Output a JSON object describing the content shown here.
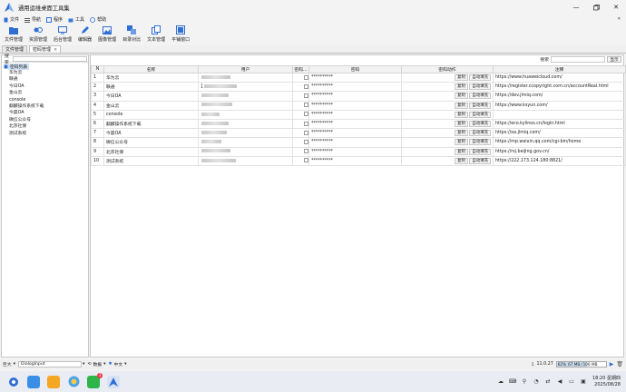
{
  "window": {
    "title": "通用运维桌面工具集",
    "controls": [
      "minimize",
      "restore",
      "close"
    ]
  },
  "menubar": [
    {
      "label": "文件",
      "icon": "file-icon"
    },
    {
      "label": "导航",
      "icon": "nav-icon"
    },
    {
      "label": "程序",
      "icon": "program-icon"
    },
    {
      "label": "工具",
      "icon": "tool-icon"
    },
    {
      "label": "帮助",
      "icon": "help-icon"
    }
  ],
  "toolbar": [
    {
      "label": "文件管理",
      "icon": "folder-icon"
    },
    {
      "label": "资源管理",
      "icon": "resource-icon"
    },
    {
      "label": "后台管理",
      "icon": "monitor-icon"
    },
    {
      "label": "编辑器",
      "icon": "edit-icon"
    },
    {
      "label": "图像管理",
      "icon": "image-icon"
    },
    {
      "label": "目录对比",
      "icon": "compare-icon"
    },
    {
      "label": "文本管理",
      "icon": "text-icon"
    },
    {
      "label": "平铺窗口",
      "icon": "tile-icon"
    }
  ],
  "tabs": [
    {
      "label": "文件管理",
      "active": false
    },
    {
      "label": "密码管理",
      "active": true
    }
  ],
  "left_panel": {
    "search_label": "搜索",
    "search_value": "",
    "root_label": "密码列表",
    "items": [
      "华为云",
      "联通",
      "今日OA",
      "金山云",
      "console",
      "麒麟操作系统下载",
      "今晨OA",
      "微信公众号",
      "北京社保",
      "测试系统"
    ]
  },
  "right_panel": {
    "search_label": "搜索",
    "show_button": "显示",
    "columns": [
      "N",
      "名称",
      "用户",
      "密码...",
      "密码",
      "密码动作",
      "注释"
    ],
    "copy_label": "复制",
    "autofill_label": "自动填充",
    "rows": [
      {
        "n": "1",
        "name": "华为云",
        "user": "",
        "password": "**********",
        "note": "https://www.huaweicloud.com/"
      },
      {
        "n": "2",
        "name": "联通",
        "user": "1",
        "password": "**********",
        "note": "https://register.ccopyright.com.cn/accountReal.html"
      },
      {
        "n": "3",
        "name": "今日OA",
        "user": "",
        "password": "**********",
        "note": "https://dev.jlmiq.com/"
      },
      {
        "n": "4",
        "name": "金山云",
        "user": "",
        "password": "**********",
        "note": "https://www.ksyun.com/"
      },
      {
        "n": "5",
        "name": "console",
        "user": "",
        "password": "**********",
        "note": ""
      },
      {
        "n": "6",
        "name": "麒麟操作系统下载",
        "user": "",
        "password": "**********",
        "note": "https://eco.kylinos.cn/login.html"
      },
      {
        "n": "7",
        "name": "今晨OA",
        "user": "",
        "password": "**********",
        "note": "https://oa.jlmiq.com/"
      },
      {
        "n": "8",
        "name": "微信公众号",
        "user": "",
        "password": "**********",
        "note": "https://mp.weixin.qq.com/cgi-bin/home"
      },
      {
        "n": "9",
        "name": "北京社保",
        "user": "",
        "password": "**********",
        "note": "https://rsj.beijing.gov.cn/"
      },
      {
        "n": "10",
        "name": "测试系统",
        "user": "",
        "password": "**********",
        "note": "https://222.173.124.180:8821/"
      }
    ]
  },
  "statusbar": {
    "font_size": "巨大",
    "component": "DialogInput",
    "mode": "数据",
    "language": "中文",
    "version": "11.0.27",
    "memory_percent": "62%",
    "memory_used": "67 MB",
    "memory_total": "106 MB",
    "memory_fraction": 0.62
  },
  "taskbar": {
    "badge_count": "3",
    "time": "18:20 星期四",
    "date": "2025/08/28"
  }
}
